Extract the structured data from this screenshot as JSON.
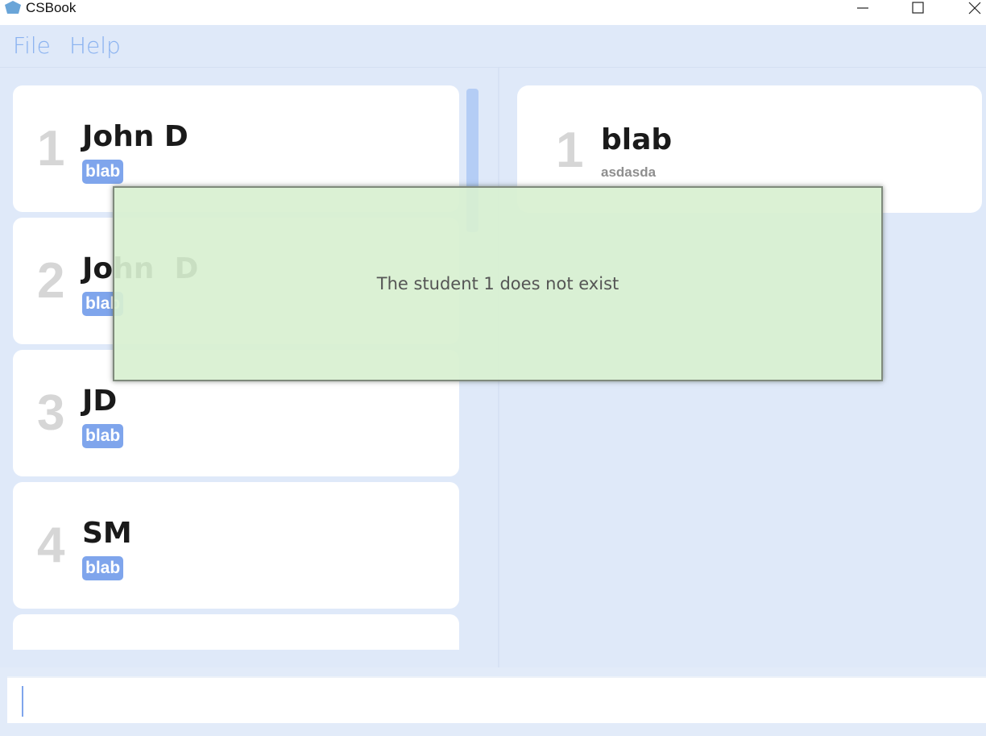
{
  "window": {
    "title": "CSBook",
    "controls": [
      "minimize",
      "maximize",
      "close"
    ]
  },
  "menu": {
    "items": [
      {
        "label": "File"
      },
      {
        "label": "Help"
      }
    ]
  },
  "student_list": [
    {
      "index": "1",
      "name": "John D",
      "tag": "blab"
    },
    {
      "index": "2",
      "name": "John  D",
      "tag": "blab"
    },
    {
      "index": "3",
      "name": "JD",
      "tag": "blab"
    },
    {
      "index": "4",
      "name": "SM",
      "tag": "blab"
    }
  ],
  "detail_panel": {
    "index": "1",
    "title": "blab",
    "description": "asdasda"
  },
  "notification": {
    "message": "The student 1 does not exist"
  },
  "command_box": {
    "value": ""
  },
  "colors": {
    "background": "#dfe9f9",
    "accent": "#7fa5ec",
    "toast": "#d8f0d0"
  }
}
